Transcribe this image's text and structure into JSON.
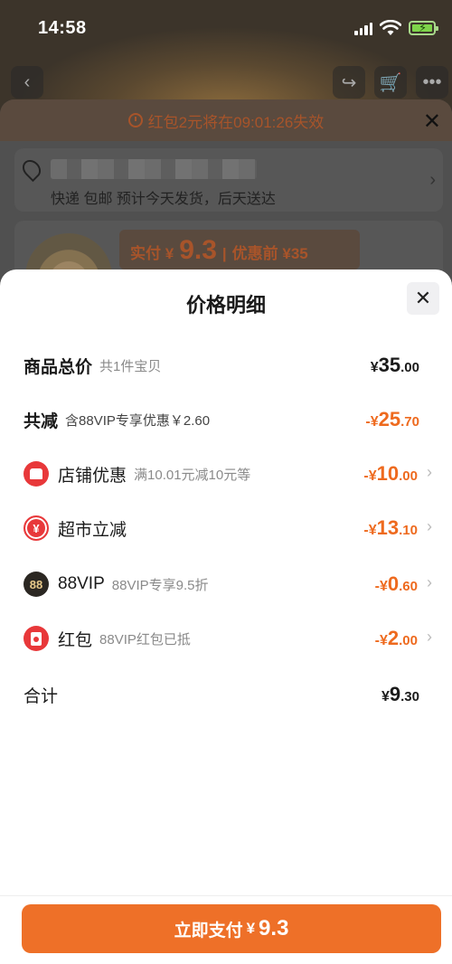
{
  "status_bar": {
    "time": "14:58"
  },
  "underlay": {
    "coupon_notice": "红包2元将在09:01:26失效",
    "delivery_text": "快递 包邮 预计今天发货，后天送达",
    "price_line": {
      "label": "实付 ¥",
      "amount": "9.3",
      "sep": "|",
      "before_label": "优惠前 ¥35"
    }
  },
  "sheet": {
    "title": "价格明细",
    "rows": [
      {
        "label": "商品总价",
        "sub": "共1件宝贝",
        "amount_sign": "",
        "amount_yen": "¥",
        "amount_int": "35",
        "amount_dec": ".00"
      },
      {
        "label": "共减",
        "sub": "含88VIP专享优惠￥2.60",
        "amount_sign": "-",
        "amount_yen": "¥",
        "amount_int": "25",
        "amount_dec": ".70"
      },
      {
        "label": "店铺优惠",
        "sub": "满10.01元减10元等",
        "amount_sign": "-",
        "amount_yen": "¥",
        "amount_int": "10",
        "amount_dec": ".00",
        "icon": "shop-icon"
      },
      {
        "label": "超市立减",
        "sub": "",
        "amount_sign": "-",
        "amount_yen": "¥",
        "amount_int": "13",
        "amount_dec": ".10",
        "icon": "yen-coin-icon",
        "icon_text": "¥"
      },
      {
        "label": "88VIP",
        "sub": "88VIP专享9.5折",
        "amount_sign": "-",
        "amount_yen": "¥",
        "amount_int": "0",
        "amount_dec": ".60",
        "icon": "vip-88-icon",
        "icon_text": "88"
      },
      {
        "label": "红包",
        "sub": "88VIP红包已抵",
        "amount_sign": "-",
        "amount_yen": "¥",
        "amount_int": "2",
        "amount_dec": ".00",
        "icon": "red-packet-icon"
      },
      {
        "label": "合计",
        "sub": "",
        "amount_sign": "",
        "amount_yen": "¥",
        "amount_int": "9",
        "amount_dec": ".30"
      }
    ],
    "close_symbol": "✕",
    "chevron": "›"
  },
  "pay_button": {
    "label": "立即支付",
    "yen": "¥",
    "value": "9.3"
  },
  "colors": {
    "accent": "#ee7028",
    "discount": "#ee6a1e",
    "red_icon": "#e8383a"
  }
}
